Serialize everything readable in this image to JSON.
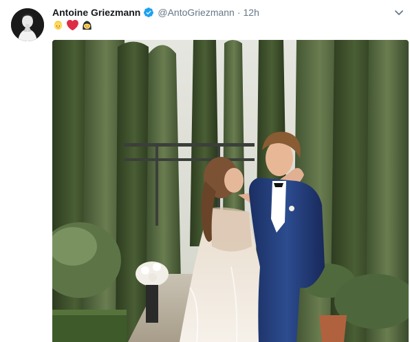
{
  "tweet": {
    "author_name": "Antoine Griezmann",
    "handle": "@AntoGriezmann",
    "separator": "·",
    "time": "12h",
    "text_emojis": [
      "blond-person-emoji",
      "red-heart-emoji",
      "woman-emoji"
    ]
  },
  "icons": {
    "verified": "verified-badge-icon",
    "caret": "chevron-down-icon"
  },
  "colors": {
    "name": "#14171a",
    "secondary_text": "#657786",
    "verified_blue": "#1da1f2",
    "heart_red": "#e0245e"
  }
}
